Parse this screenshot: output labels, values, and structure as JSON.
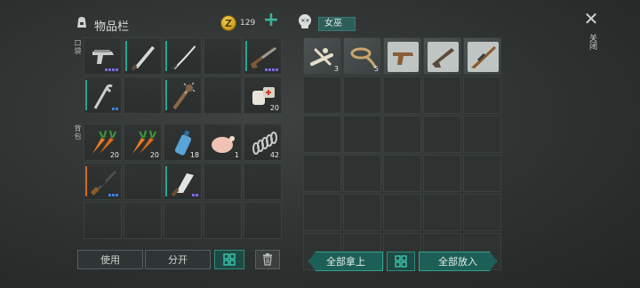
{
  "inventory": {
    "title": "物品栏",
    "coins": "129",
    "coin_symbol": "Z",
    "pocket_label": "口袋",
    "backpack_label": "背包",
    "pocket_slots": [
      {
        "item": "pistol-icon",
        "qty": "",
        "dots": 4,
        "dot_color": "purple",
        "bar": ""
      },
      {
        "item": "machete-icon",
        "qty": "",
        "dots": 0,
        "dot_color": "",
        "bar": "teal"
      },
      {
        "item": "katana-icon",
        "qty": "",
        "dots": 0,
        "dot_color": "",
        "bar": "teal"
      },
      {
        "item": "empty",
        "qty": "",
        "dots": 0,
        "dot_color": "",
        "bar": ""
      },
      {
        "item": "shotgun-icon",
        "qty": "",
        "dots": 4,
        "dot_color": "purple",
        "bar": "teal"
      },
      {
        "item": "crowbar-icon",
        "qty": "",
        "dots": 2,
        "dot_color": "blue",
        "bar": "teal"
      },
      {
        "item": "empty",
        "qty": "",
        "dots": 0,
        "dot_color": "",
        "bar": ""
      },
      {
        "item": "spiked-bat-icon",
        "qty": "",
        "dots": 0,
        "dot_color": "",
        "bar": "teal"
      },
      {
        "item": "empty",
        "qty": "",
        "dots": 0,
        "dot_color": "",
        "bar": ""
      },
      {
        "item": "medkit-icon",
        "qty": "20",
        "dots": 0,
        "dot_color": "",
        "bar": ""
      }
    ],
    "backpack_slots": [
      {
        "item": "carrot-icon",
        "qty": "20",
        "dots": 0,
        "dot_color": "",
        "bar": ""
      },
      {
        "item": "carrot-icon",
        "qty": "20",
        "dots": 0,
        "dot_color": "",
        "bar": ""
      },
      {
        "item": "water-bottle-icon",
        "qty": "18",
        "dots": 0,
        "dot_color": "",
        "bar": ""
      },
      {
        "item": "chicken-icon",
        "qty": "1",
        "dots": 0,
        "dot_color": "",
        "bar": ""
      },
      {
        "item": "spring-icon",
        "qty": "42",
        "dots": 0,
        "dot_color": "",
        "bar": ""
      },
      {
        "item": "rifle-icon",
        "qty": "",
        "dots": 3,
        "dot_color": "blue",
        "bar": "orange"
      },
      {
        "item": "empty",
        "qty": "",
        "dots": 0,
        "dot_color": "",
        "bar": ""
      },
      {
        "item": "cleaver-icon",
        "qty": "",
        "dots": 2,
        "dot_color": "purple",
        "bar": "teal"
      },
      {
        "item": "empty",
        "qty": "",
        "dots": 0,
        "dot_color": "",
        "bar": ""
      },
      {
        "item": "empty",
        "qty": "",
        "dots": 0,
        "dot_color": "",
        "bar": ""
      },
      {
        "item": "empty",
        "qty": "",
        "dots": 0,
        "dot_color": "",
        "bar": ""
      },
      {
        "item": "empty",
        "qty": "",
        "dots": 0,
        "dot_color": "",
        "bar": ""
      },
      {
        "item": "empty",
        "qty": "",
        "dots": 0,
        "dot_color": "",
        "bar": ""
      },
      {
        "item": "empty",
        "qty": "",
        "dots": 0,
        "dot_color": "",
        "bar": ""
      },
      {
        "item": "empty",
        "qty": "",
        "dots": 0,
        "dot_color": "",
        "bar": ""
      }
    ]
  },
  "loot": {
    "name": "女巫",
    "slots": [
      {
        "item": "bones-icon",
        "qty": "3",
        "filled": true
      },
      {
        "item": "rope-icon",
        "qty": "5",
        "filled": true
      },
      {
        "item": "pistol-blueprint-icon",
        "qty": "",
        "filled": true
      },
      {
        "item": "smg-blueprint-icon",
        "qty": "",
        "filled": true
      },
      {
        "item": "rifle-blueprint-icon",
        "qty": "",
        "filled": true
      }
    ],
    "empty_rows": 5
  },
  "buttons": {
    "use": "使用",
    "split": "分开",
    "take_all": "全部拿上",
    "put_all": "全部放入",
    "close": "关闭"
  },
  "colors": {
    "accent": "#2e8b7d",
    "purple_dot": "#7b6be0",
    "blue_dot": "#3f7fd6",
    "teal_bar": "#27a891",
    "orange_bar": "#d66b1e"
  }
}
